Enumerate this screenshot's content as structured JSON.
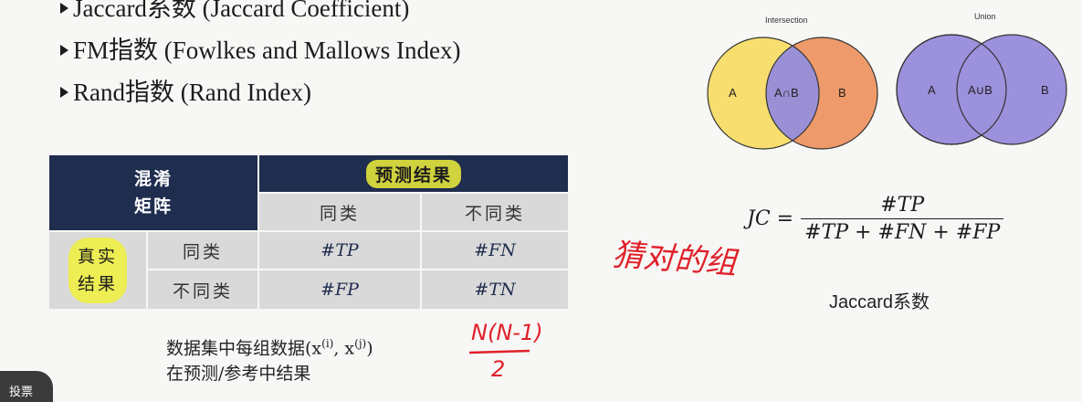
{
  "bullets": [
    "Jaccard系数 (Jaccard Coefficient)",
    "FM指数 (Fowlkes and Mallows Index)",
    "Rand指数 (Rand Index)"
  ],
  "table": {
    "corner": "混淆\n矩阵",
    "pred_header": "预测结果",
    "pred_same": "同类",
    "pred_diff": "不同类",
    "actual_header": "真实\n结果",
    "row_same": "同类",
    "row_diff": "不同类",
    "tp": "#TP",
    "fn": "#FN",
    "fp": "#FP",
    "tn": "#TN"
  },
  "caption_line1": "数据集中每组数据(x",
  "caption_sup_i": "(i)",
  "caption_sep": ", x",
  "caption_sup_j": "(j)",
  "caption_close": ")",
  "caption_line2": "在预测/参考中结果",
  "venn": {
    "intersection_title": "Intersection",
    "union_title": "Union",
    "a": "A",
    "b": "B",
    "a_and_b": "A∩B",
    "a_or_b": "A∪B",
    "colors": {
      "a": "#f7de6e",
      "b": "#ee9a6a",
      "overlap": "#9b8fd6",
      "union": "#9b91dc",
      "stroke": "#333333"
    }
  },
  "formula": {
    "lhs": "JC =",
    "numerator": "#TP",
    "denominator": "#TP + #FN + #FP"
  },
  "jaccard_label": "Jaccard系数",
  "handwriting": {
    "note1": "猜对的组",
    "note2": "N(N-1)",
    "note3": "2",
    "color": "#e0202a"
  },
  "vote_button": "投票"
}
